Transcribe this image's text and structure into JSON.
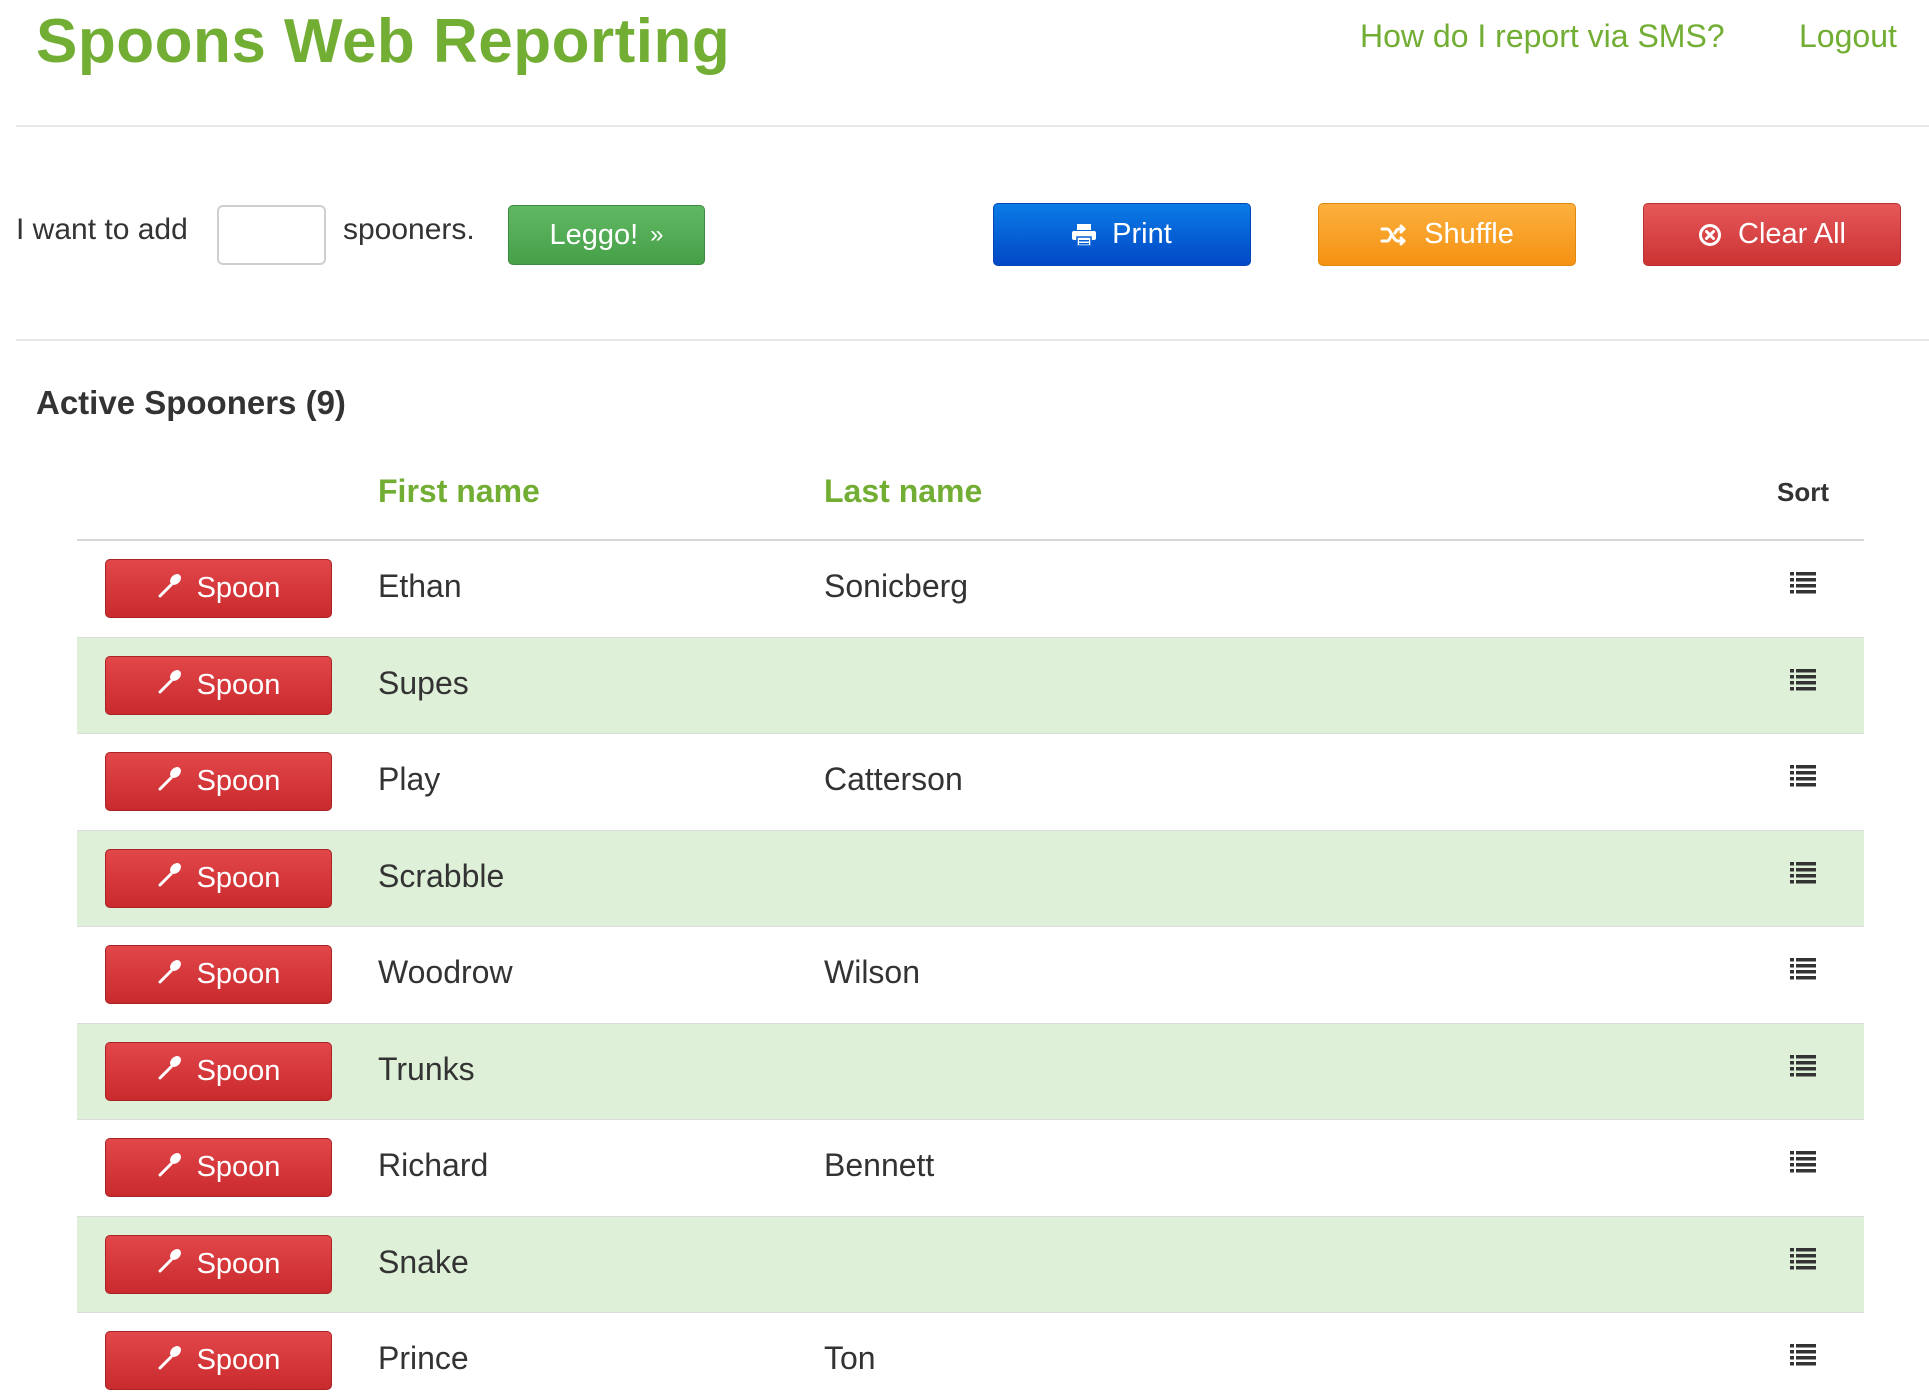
{
  "header": {
    "title": "Spoons Web Reporting",
    "sms_link": "How do I report via SMS?",
    "logout_link": "Logout"
  },
  "add_bar": {
    "prefix": "I want to add",
    "input_value": "",
    "suffix": "spooners.",
    "leggo_label": "Leggo!",
    "leggo_icon": "»"
  },
  "actions": {
    "print_label": "Print",
    "shuffle_label": "Shuffle",
    "clear_label": "Clear All"
  },
  "section": {
    "title": "Active Spooners (9)"
  },
  "table": {
    "headers": {
      "first": "First name",
      "last": "Last name",
      "sort": "Sort"
    },
    "spoon_label": "Spoon",
    "rows": [
      {
        "first": "Ethan",
        "last": "Sonicberg"
      },
      {
        "first": "Supes",
        "last": ""
      },
      {
        "first": "Play",
        "last": "Catterson"
      },
      {
        "first": "Scrabble",
        "last": ""
      },
      {
        "first": "Woodrow",
        "last": "Wilson"
      },
      {
        "first": "Trunks",
        "last": ""
      },
      {
        "first": "Richard",
        "last": "Bennett"
      },
      {
        "first": "Snake",
        "last": ""
      },
      {
        "first": "Prince",
        "last": "Ton"
      }
    ]
  },
  "colors": {
    "brand_green": "#72ad34",
    "row_alt": "#dff0d8",
    "leggo": "#4ea94f",
    "print": "#0560d6",
    "shuffle": "#f7a127",
    "clear": "#d83f40",
    "spoon": "#d5373a"
  }
}
